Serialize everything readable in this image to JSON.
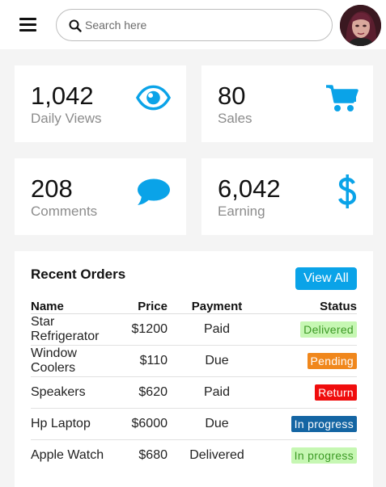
{
  "header": {
    "search_placeholder": "Search here"
  },
  "stats": [
    {
      "value": "1,042",
      "label": "Daily Views",
      "icon": "eye-icon"
    },
    {
      "value": "80",
      "label": "Sales",
      "icon": "cart-icon"
    },
    {
      "value": "208",
      "label": "Comments",
      "icon": "comment-icon"
    },
    {
      "value": "6,042",
      "label": "Earning",
      "icon": "dollar-icon"
    }
  ],
  "accent_color": "#0aa3e8",
  "orders": {
    "title": "Recent Orders",
    "view_all_label": "View All",
    "columns": [
      "Name",
      "Price",
      "Payment",
      "Status"
    ],
    "rows": [
      {
        "name": "Star Refrigerator",
        "price": "$1200",
        "payment": "Paid",
        "status": "Delivered",
        "status_bg": "#c6f7b3",
        "status_fg": "#3d9a26"
      },
      {
        "name": "Window Coolers",
        "price": "$110",
        "payment": "Due",
        "status": "Pending",
        "status_bg": "#f0871c",
        "status_fg": "#ffffff"
      },
      {
        "name": "Speakers",
        "price": "$620",
        "payment": "Paid",
        "status": "Return",
        "status_bg": "#f00d0d",
        "status_fg": "#ffffff"
      },
      {
        "name": "Hp Laptop",
        "price": "$6000",
        "payment": "Due",
        "status": "In progress",
        "status_bg": "#1465a3",
        "status_fg": "#ffffff"
      },
      {
        "name": "Apple Watch",
        "price": "$680",
        "payment": "Delivered",
        "status": "In progress",
        "status_bg": "#c6f7b3",
        "status_fg": "#3d9a26"
      }
    ]
  }
}
